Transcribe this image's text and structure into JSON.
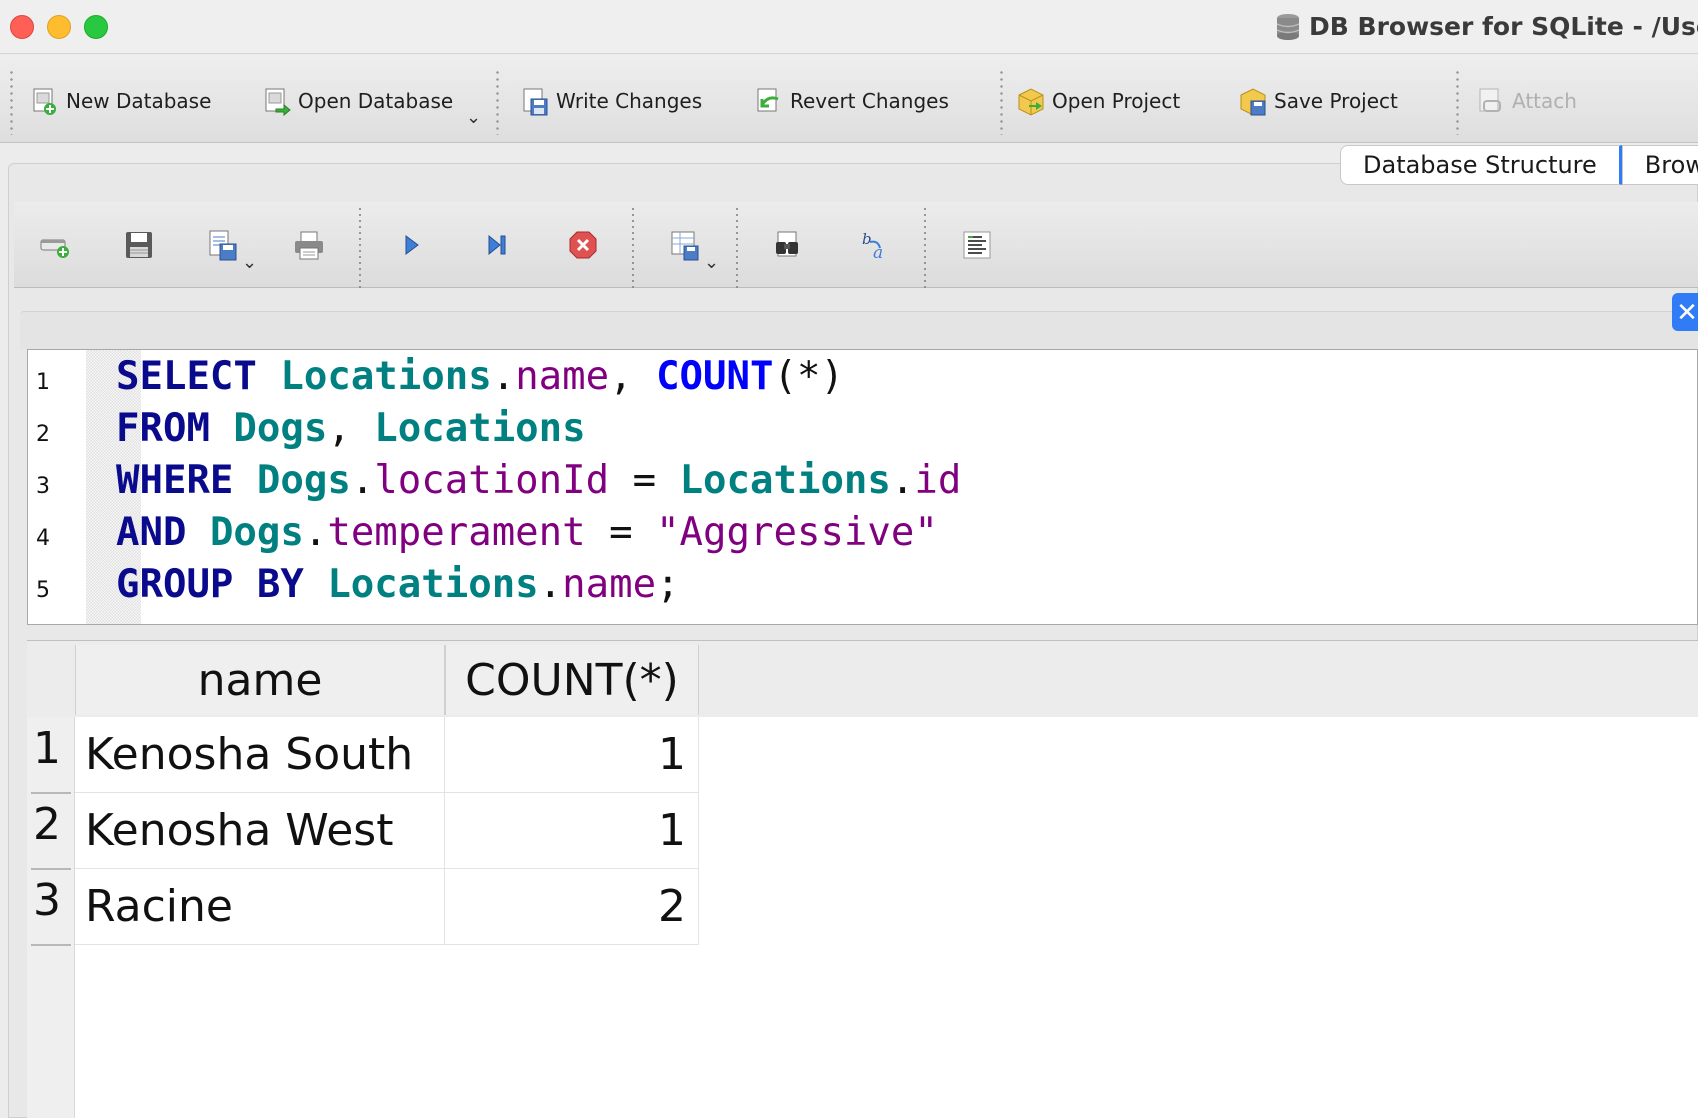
{
  "window": {
    "title": "DB Browser for SQLite - /User"
  },
  "toolbar": {
    "new_database": "New Database",
    "open_database": "Open Database",
    "write_changes": "Write Changes",
    "revert_changes": "Revert Changes",
    "open_project": "Open Project",
    "save_project": "Save Project",
    "attach": "Attach"
  },
  "tabs": [
    "Database Structure",
    "Brow"
  ],
  "editor": {
    "line_numbers": [
      "1",
      "2",
      "3",
      "4",
      "5"
    ]
  },
  "results": {
    "columns": [
      "name",
      "COUNT(*)"
    ],
    "rows": [
      {
        "num": "1",
        "name": "Kenosha South",
        "count": "1"
      },
      {
        "num": "2",
        "name": "Kenosha West",
        "count": "1"
      },
      {
        "num": "3",
        "name": "Racine",
        "count": "2"
      }
    ]
  },
  "colors": {
    "keyword": "#0a0a8c",
    "function": "#0000ff",
    "table": "#008080",
    "column": "#800080",
    "accent": "#2f7cf6"
  }
}
